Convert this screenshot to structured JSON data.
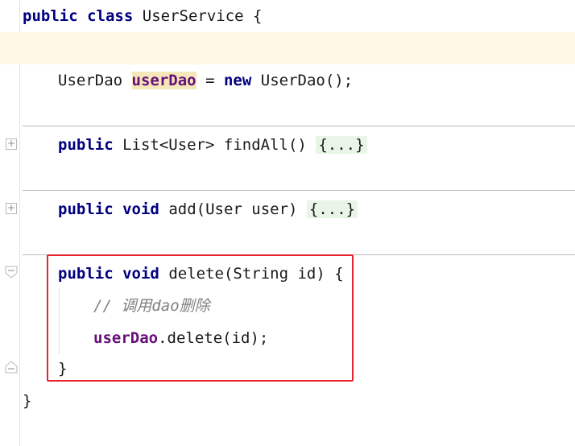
{
  "editor": {
    "class_decl": {
      "kw1": "public",
      "kw2": "class",
      "name": "UserService",
      "brace": "{"
    },
    "field_line": {
      "type": "UserDao",
      "name": "userDao",
      "eq": "=",
      "kw_new": "new",
      "ctor": "UserDao();"
    },
    "find_all": {
      "kw1": "public",
      "sig": "List<User> findAll()",
      "folded": "{...}"
    },
    "add": {
      "kw1": "public",
      "kw2": "void",
      "sig": "add(User user)",
      "folded": "{...}"
    },
    "delete": {
      "kw1": "public",
      "kw2": "void",
      "sig": "delete(String id)",
      "brace": "{"
    },
    "comment": "// 调用dao删除",
    "call": {
      "target": "userDao",
      "rest": ".delete(id);"
    },
    "close_method": "}",
    "close_class": "}",
    "icons": [
      "fold-expand-icon",
      "fold-collapse-icon",
      "fold-end-icon"
    ],
    "colors": {
      "keyword": "#000080",
      "field": "#660e7a",
      "comment": "#808080",
      "highlight_box": "#e6242f",
      "current_line": "#fdf9e5"
    }
  }
}
